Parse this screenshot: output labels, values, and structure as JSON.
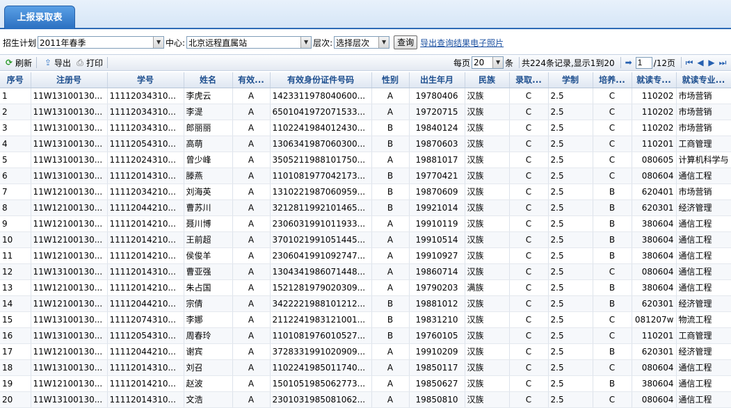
{
  "tab": {
    "label": "上报录取表"
  },
  "search": {
    "plan_label": "招生计划",
    "plan_value": "2011年春季",
    "center_label": "中心:",
    "center_value": "北京远程直属站",
    "level_label": "层次:",
    "level_value": "选择层次",
    "query_button": "查询",
    "export_photos_link": "导出查询结果电子照片"
  },
  "toolbar": {
    "refresh": "刷新",
    "export": "导出",
    "print": "打印",
    "per_page_label": "每页",
    "per_page_value": "20",
    "per_page_unit": "条",
    "records_summary": "共224条记录,显示1到20",
    "page_value": "1",
    "total_pages": "/12页"
  },
  "grid": {
    "headers": [
      "序号",
      "注册号",
      "学号",
      "姓名",
      "有效...",
      "有效身份证件号码",
      "性别",
      "出生年月",
      "民族",
      "录取...",
      "学制",
      "培养...",
      "就读专...",
      "就读专业..."
    ],
    "rows": [
      [
        "1",
        "11W13100130...",
        "11112034310...",
        "李虎云",
        "A",
        "1423311978040600...",
        "A",
        "19780406",
        "汉族",
        "C",
        "2.5",
        "C",
        "110202",
        "市场营销"
      ],
      [
        "2",
        "11W13100130...",
        "11112034310...",
        "李湜",
        "A",
        "6501041972071533...",
        "A",
        "19720715",
        "汉族",
        "C",
        "2.5",
        "C",
        "110202",
        "市场营销"
      ],
      [
        "3",
        "11W13100130...",
        "11112034310...",
        "郎丽丽",
        "A",
        "1102241984012430...",
        "B",
        "19840124",
        "汉族",
        "C",
        "2.5",
        "C",
        "110202",
        "市场营销"
      ],
      [
        "4",
        "11W13100130...",
        "11112054310...",
        "高萌",
        "A",
        "1306341987060300...",
        "B",
        "19870603",
        "汉族",
        "C",
        "2.5",
        "C",
        "110201",
        "工商管理"
      ],
      [
        "5",
        "11W13100130...",
        "11112024310...",
        "曾少峰",
        "A",
        "3505211988101750...",
        "A",
        "19881017",
        "汉族",
        "C",
        "2.5",
        "C",
        "080605",
        "计算机科学与"
      ],
      [
        "6",
        "11W13100130...",
        "11112014310...",
        "滕燕",
        "A",
        "1101081977042173...",
        "B",
        "19770421",
        "汉族",
        "C",
        "2.5",
        "C",
        "080604",
        "通信工程"
      ],
      [
        "7",
        "11W12100130...",
        "11112034210...",
        "刘海英",
        "A",
        "1310221987060959...",
        "B",
        "19870609",
        "汉族",
        "C",
        "2.5",
        "B",
        "620401",
        "市场营销"
      ],
      [
        "8",
        "11W12100130...",
        "11112044210...",
        "曹苏川",
        "A",
        "3212811992101465...",
        "B",
        "19921014",
        "汉族",
        "C",
        "2.5",
        "B",
        "620301",
        "经济管理"
      ],
      [
        "9",
        "11W12100130...",
        "11112014210...",
        "聂川博",
        "A",
        "2306031991011933...",
        "A",
        "19910119",
        "汉族",
        "C",
        "2.5",
        "B",
        "380604",
        "通信工程"
      ],
      [
        "10",
        "11W12100130...",
        "11112014210...",
        "王前超",
        "A",
        "3701021991051445...",
        "A",
        "19910514",
        "汉族",
        "C",
        "2.5",
        "B",
        "380604",
        "通信工程"
      ],
      [
        "11",
        "11W12100130...",
        "11112014210...",
        "侯俊羊",
        "A",
        "2306041991092747...",
        "A",
        "19910927",
        "汉族",
        "C",
        "2.5",
        "B",
        "380604",
        "通信工程"
      ],
      [
        "12",
        "11W13100130...",
        "11112014310...",
        "曹亚强",
        "A",
        "1304341986071448...",
        "A",
        "19860714",
        "汉族",
        "C",
        "2.5",
        "C",
        "080604",
        "通信工程"
      ],
      [
        "13",
        "11W12100130...",
        "11112014210...",
        "朱占国",
        "A",
        "1521281979020309...",
        "A",
        "19790203",
        "满族",
        "C",
        "2.5",
        "B",
        "380604",
        "通信工程"
      ],
      [
        "14",
        "11W12100130...",
        "11112044210...",
        "宗倩",
        "A",
        "3422221988101212...",
        "B",
        "19881012",
        "汉族",
        "C",
        "2.5",
        "B",
        "620301",
        "经济管理"
      ],
      [
        "15",
        "11W13100130...",
        "11112074310...",
        "李娜",
        "A",
        "2112241983121001...",
        "B",
        "19831210",
        "汉族",
        "C",
        "2.5",
        "C",
        "081207w",
        "物流工程"
      ],
      [
        "16",
        "11W13100130...",
        "11112054310...",
        "周春玲",
        "A",
        "1101081976010527...",
        "B",
        "19760105",
        "汉族",
        "C",
        "2.5",
        "C",
        "110201",
        "工商管理"
      ],
      [
        "17",
        "11W12100130...",
        "11112044210...",
        "谢宾",
        "A",
        "3728331991020909...",
        "A",
        "19910209",
        "汉族",
        "C",
        "2.5",
        "B",
        "620301",
        "经济管理"
      ],
      [
        "18",
        "11W13100130...",
        "11112014310...",
        "刘召",
        "A",
        "1102241985011740...",
        "A",
        "19850117",
        "汉族",
        "C",
        "2.5",
        "C",
        "080604",
        "通信工程"
      ],
      [
        "19",
        "11W12100130...",
        "11112014210...",
        "赵波",
        "A",
        "1501051985062773...",
        "A",
        "19850627",
        "汉族",
        "C",
        "2.5",
        "B",
        "380604",
        "通信工程"
      ],
      [
        "20",
        "11W13100130...",
        "11112014310...",
        "文浩",
        "A",
        "2301031985081062...",
        "A",
        "19850810",
        "汉族",
        "C",
        "2.5",
        "C",
        "080604",
        "通信工程"
      ]
    ]
  }
}
